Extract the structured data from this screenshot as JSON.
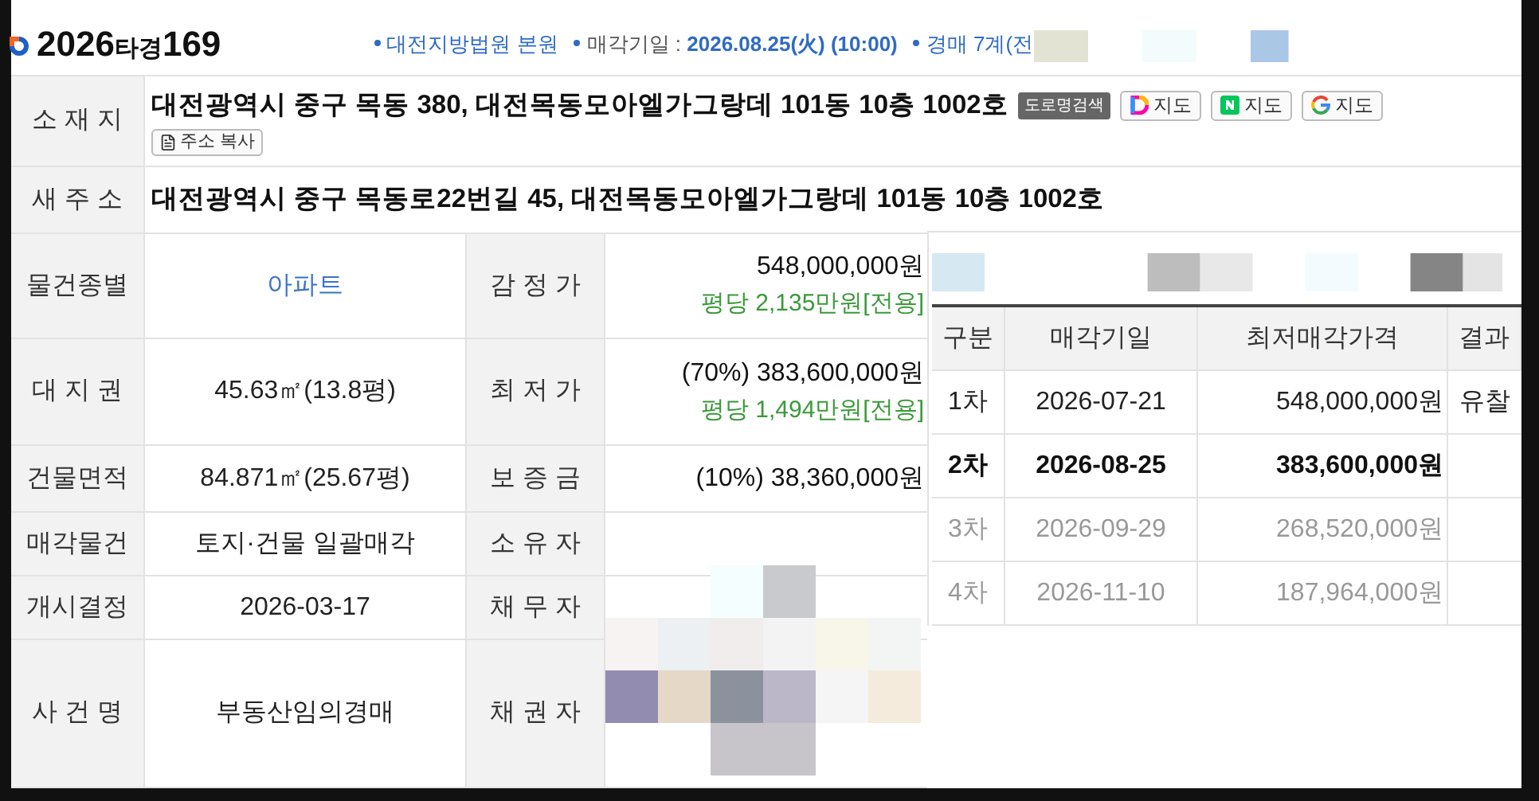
{
  "header": {
    "case_year": "2026",
    "case_type": "타경",
    "case_serial": "169",
    "info": [
      {
        "value": "대전지방법원 본원"
      },
      {
        "label": "매각기일 : ",
        "value": "2026.08.25(火) (10:00)"
      },
      {
        "value": "경매 7계(전"
      }
    ]
  },
  "address": {
    "label": "소 재 지",
    "text": "대전광역시 중구 목동 380, 대전목동모아엘가그랑데 101동 10층 1002호",
    "buttons": [
      {
        "kind": "road",
        "label": "도로명검색"
      },
      {
        "kind": "daum",
        "label": "지도"
      },
      {
        "kind": "naver",
        "label": "지도"
      },
      {
        "kind": "google",
        "label": "지도"
      }
    ],
    "copy_button": "주소 복사"
  },
  "new_address": {
    "label": "새 주 소",
    "text": "대전광역시 중구 목동로22번길 45, 대전목동모아엘가그랑데 101동 10층 1002호"
  },
  "details": [
    {
      "label": "물건종별",
      "value": "아파트",
      "kind": "link",
      "label2": "감 정 가",
      "amount": "548,000,000원",
      "per_pyeong": "평당 2,135만원[전용]"
    },
    {
      "label": "대 지 권",
      "value": "45.63㎡(13.8평)",
      "kind": "text",
      "label2": "최 저 가",
      "amount": "(70%) 383,600,000원",
      "per_pyeong": "평당 1,494만원[전용]"
    },
    {
      "label": "건물면적",
      "value": "84.871㎡(25.67평)",
      "kind": "text",
      "label2": "보 증 금",
      "amount": "(10%) 38,360,000원"
    },
    {
      "label": "매각물건",
      "value": "토지·건물 일괄매각",
      "kind": "text",
      "label2": "소 유 자"
    },
    {
      "label": "개시결정",
      "value": "2026-03-17",
      "kind": "text",
      "label2": "채 무 자"
    },
    {
      "label": "사 건 명",
      "value": "부동산임의경매",
      "kind": "text",
      "label2": "채 권 자"
    }
  ],
  "schedule": {
    "columns": [
      "구분",
      "매각기일",
      "최저매각가격",
      "결과"
    ],
    "rows": [
      {
        "round": "1차",
        "date": "2026-07-21",
        "price": "548,000,000원",
        "result": "유찰",
        "kind": "past"
      },
      {
        "round": "2차",
        "date": "2026-08-25",
        "price": "383,600,000원",
        "kind": "current"
      },
      {
        "round": "3차",
        "date": "2026-09-29",
        "price": "268,520,000원",
        "kind": "future"
      },
      {
        "round": "4차",
        "date": "2026-11-10",
        "price": "187,964,000원",
        "kind": "future"
      }
    ]
  }
}
